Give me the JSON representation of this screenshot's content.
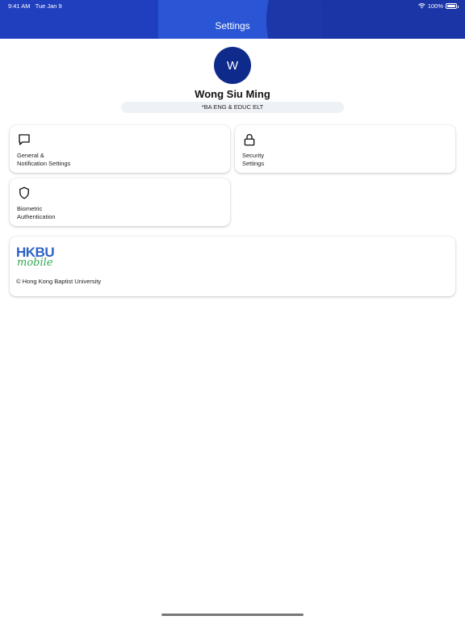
{
  "status_bar": {
    "time": "9:41 AM",
    "date": "Tue Jan 9",
    "battery": "100%"
  },
  "header": {
    "title": "Settings"
  },
  "profile": {
    "initial": "W",
    "name": "Wong Siu Ming",
    "program": "*BA ENG & EDUC ELT"
  },
  "settings": {
    "general_label": "General &\nNotification Settings",
    "security_label": "Security\nSettings",
    "biometric_label": "Biometric\nAuthentication"
  },
  "about": {
    "logo_top": "HKBU",
    "logo_bottom": "mobile",
    "copyright": "© Hong Kong Baptist University"
  },
  "icons": {
    "general": "chat-bubble-icon",
    "security": "lock-icon",
    "biometric": "shield-icon"
  },
  "colors": {
    "header_bg": "#1f3fbf",
    "avatar_bg": "#0e2a8a",
    "logo_blue": "#2d62c8",
    "logo_green": "#34a853"
  }
}
